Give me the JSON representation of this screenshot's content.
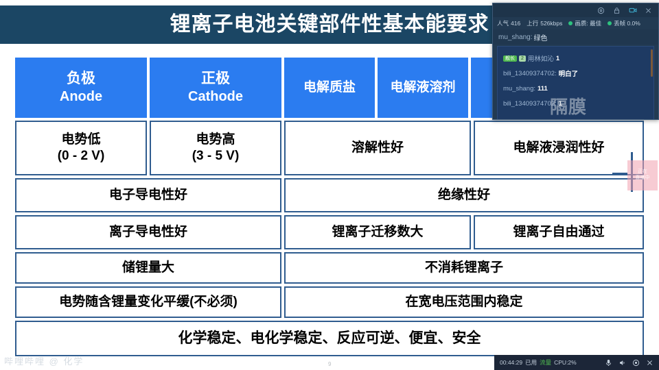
{
  "slide": {
    "title": "锂离子电池关键部件性基本能要求",
    "page_number": "9",
    "watermark_bottom_left": "哔哩哔哩 @ 化学",
    "watermark_overlay_text": "隔膜"
  },
  "table": {
    "rows": [
      {
        "type": "header",
        "cells": [
          {
            "main": "负极",
            "sub": "Anode",
            "flex": 192
          },
          {
            "main": "正极",
            "sub": "Cathode",
            "flex": 192
          },
          {
            "main": "电解质盐",
            "sub": "",
            "flex": 132
          },
          {
            "main": "电解液溶剂",
            "sub": "",
            "flex": 132
          },
          {
            "main": "隔膜",
            "sub": "",
            "flex": 253
          }
        ]
      },
      {
        "type": "body",
        "cells": [
          {
            "main": "电势低",
            "sub": "(0 - 2 V)",
            "flex": 192
          },
          {
            "main": "电势高",
            "sub": "(3 - 5 V)",
            "flex": 192
          },
          {
            "main": "溶解性好",
            "sub": "",
            "flex": 272
          },
          {
            "main": "电解液浸润性好",
            "sub": "",
            "flex": 253
          }
        ]
      },
      {
        "type": "body",
        "cells": [
          {
            "main": "电子导电性好",
            "sub": "",
            "flex": 388
          },
          {
            "main": "绝缘性好",
            "sub": "",
            "flex": 529
          }
        ]
      },
      {
        "type": "body",
        "cells": [
          {
            "main": "离子导电性好",
            "sub": "",
            "flex": 388
          },
          {
            "main": "锂离子迁移数大",
            "sub": "",
            "flex": 272
          },
          {
            "main": "锂离子自由通过",
            "sub": "",
            "flex": 253
          }
        ]
      },
      {
        "type": "body",
        "cells": [
          {
            "main": "储锂量大",
            "sub": "",
            "flex": 388
          },
          {
            "main": "不消耗锂离子",
            "sub": "",
            "flex": 529
          }
        ]
      },
      {
        "type": "body",
        "cells": [
          {
            "main": "电势随含锂量变化平缓(不必须)",
            "sub": "",
            "flex": 388
          },
          {
            "main": "在宽电压范围内稳定",
            "sub": "",
            "flex": 529
          }
        ]
      },
      {
        "type": "body",
        "cells": [
          {
            "main": "化学稳定、电化学稳定、反应可逆、便宜、安全",
            "sub": "",
            "flex": 916
          }
        ]
      }
    ]
  },
  "live_panel": {
    "titlebar_icons": [
      "settings-icon",
      "lock-icon",
      "camera-icon",
      "close-icon"
    ],
    "stats": {
      "popularity_label": "人气",
      "popularity_value": "416",
      "upload_label": "上行",
      "upload_value": "526kbps",
      "quality_label": "画质: 最佳",
      "framedrop_label": "丢帧 0.0%"
    },
    "subtitle_user": "mu_shang:",
    "subtitle_text": "绿色",
    "chat": [
      {
        "badge1": "舰长",
        "badge2": "2",
        "user": "用林如沁",
        "msg": "1"
      },
      {
        "badge1": "",
        "badge2": "",
        "user": "bili_13409374702:",
        "msg": "明白了"
      },
      {
        "badge1": "",
        "badge2": "",
        "user": "mu_shang:",
        "msg": "111"
      },
      {
        "badge1": "",
        "badge2": "",
        "user": "bili_13409374702:",
        "msg": "1"
      }
    ]
  },
  "bottom_bar": {
    "elapsed": "00:44:29",
    "status_label": "已用",
    "status_highlight": "流量",
    "cpu": "CPU:2%",
    "icons": [
      "microphone-icon",
      "speaker-icon",
      "record-icon",
      "close-icon"
    ]
  },
  "float_badge": {
    "line1": "正在",
    "line2": "直播中"
  },
  "colors": {
    "title_bg": "#1b4664",
    "header_cell": "#2b7cf0",
    "cell_border": "#2f5c8f",
    "panel_bg": "#223a52",
    "chat_bg": "#1e3a63",
    "status_green": "#2ec27e",
    "accent_cyan": "#3fb6d8"
  }
}
